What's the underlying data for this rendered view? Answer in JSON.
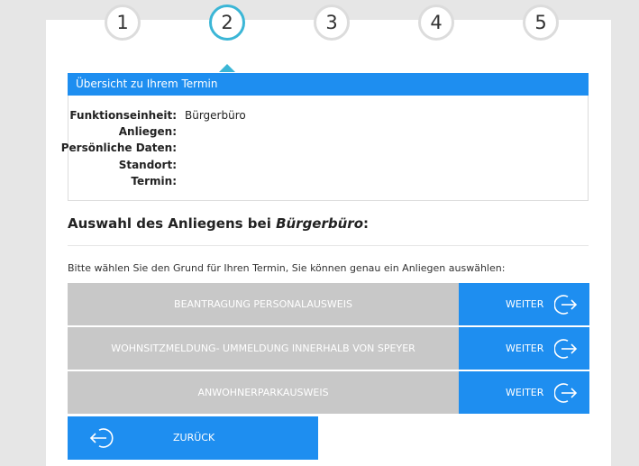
{
  "steps": [
    "1",
    "2",
    "3",
    "4",
    "5"
  ],
  "summary": {
    "title": "Übersicht zu Ihrem Termin",
    "rows": [
      {
        "label": "Funktionseinheit:",
        "value": "Bürgerbüro"
      },
      {
        "label": "Anliegen:",
        "value": ""
      },
      {
        "label": "Persönliche Daten:",
        "value": ""
      },
      {
        "label": "Standort:",
        "value": ""
      },
      {
        "label": "Termin:",
        "value": ""
      }
    ]
  },
  "section": {
    "title_prefix": "Auswahl des Anliegens bei ",
    "title_emphasis": "Bürgerbüro",
    "title_suffix": ":",
    "instruction": "Bitte wählen Sie den Grund für Ihren Termin, Sie können genau ein Anliegen auswählen:"
  },
  "services": [
    {
      "name": "BEANTRAGUNG PERSONALAUSWEIS",
      "button": "WEITER"
    },
    {
      "name": "WOHNSITZMELDUNG- UMMELDUNG INNERHALB VON SPEYER",
      "button": "WEITER"
    },
    {
      "name": "ANWOHNERPARKAUSWEIS",
      "button": "WEITER"
    }
  ],
  "back": {
    "label": "ZURÜCK"
  },
  "colors": {
    "primary": "#1e8ef0",
    "active_step": "#3bb6d6",
    "service_bg": "#c8c8c8"
  },
  "icons": {
    "forward": "exit-arrow-right-icon",
    "back": "exit-arrow-left-icon"
  }
}
